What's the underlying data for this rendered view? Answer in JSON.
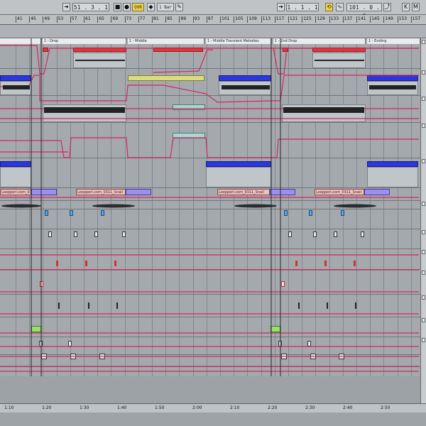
{
  "transport": {
    "position": "51 . 3 . 1",
    "ovr_label": "OVR",
    "quantize": "1 Bar",
    "loop_start": "1 . 1 . 1",
    "loop_length": "101 . 0 . 0"
  },
  "ruler": {
    "bars": [
      "41",
      "45",
      "49",
      "53",
      "57",
      "61",
      "65",
      "69",
      "73",
      "77",
      "81",
      "85",
      "89",
      "93",
      "97",
      "101",
      "105",
      "109",
      "113",
      "117",
      "121",
      "125",
      "129",
      "133",
      "137",
      "141",
      "145",
      "149",
      "153",
      "157"
    ]
  },
  "scenes": [
    "1 - Drop",
    "1 - Middle",
    "1 - Middle Transient Melodies",
    "1 - 2nd Drop",
    "1 - Ending"
  ],
  "clip_name": "Loopperl.com_0311_Snail",
  "time_labels": [
    "1:10",
    "1:20",
    "1:30",
    "1:40",
    "1:50",
    "2:00",
    "2:10",
    "2:20",
    "2:30",
    "2:40",
    "2:50"
  ],
  "colors": {
    "clip_red": "#ea3333",
    "clip_blue": "#2b35e0",
    "automation": "#d8265d"
  }
}
